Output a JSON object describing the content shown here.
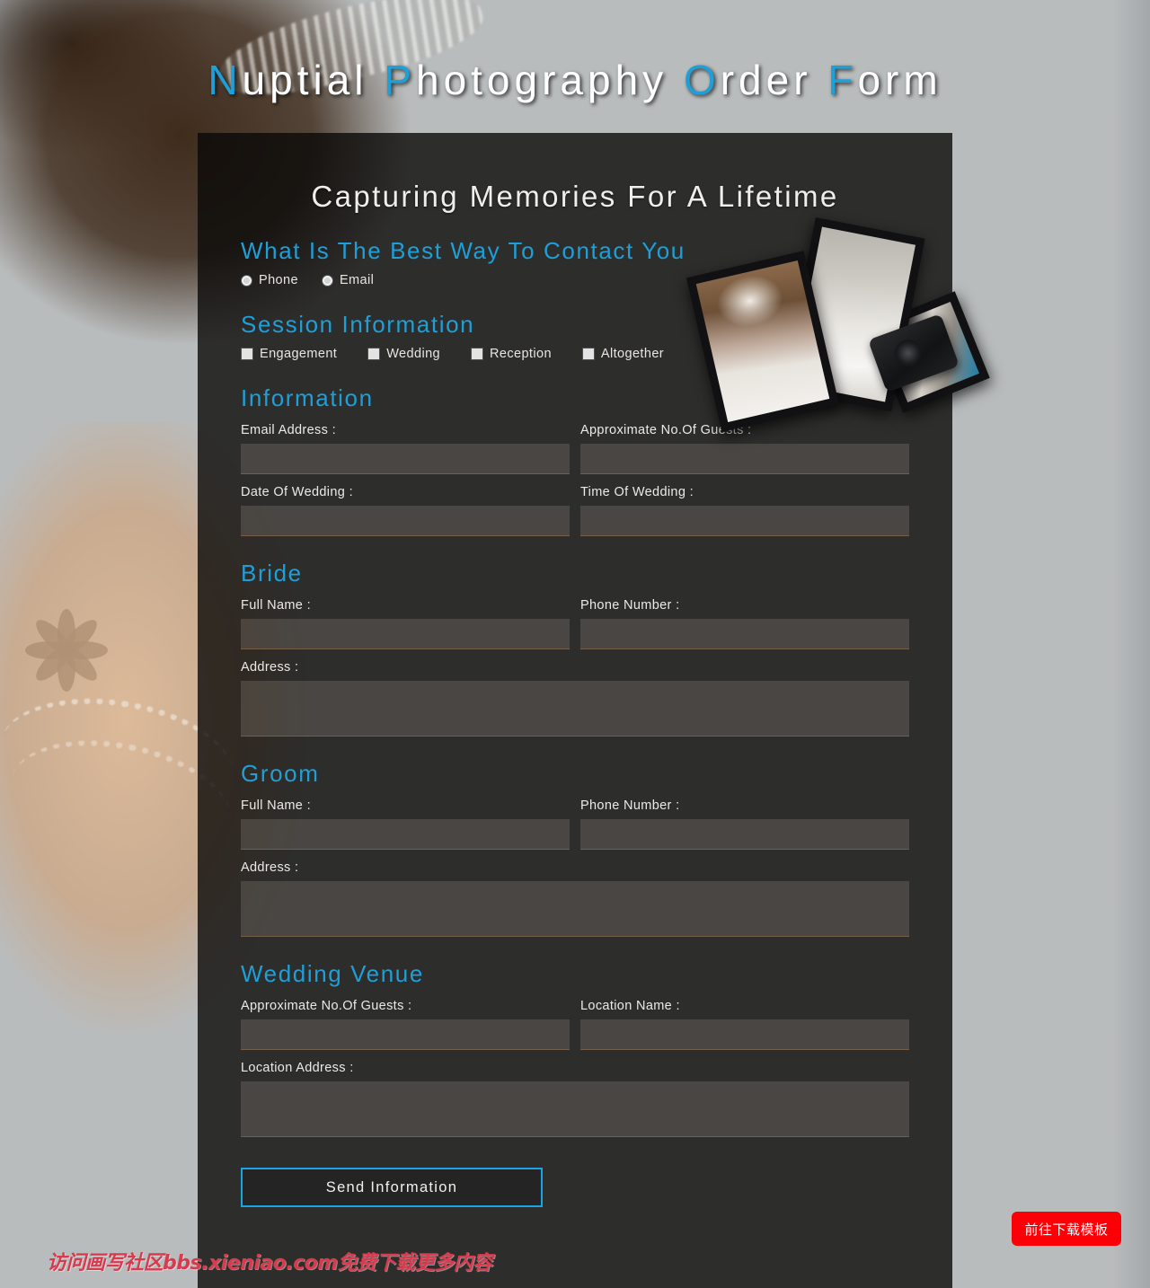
{
  "header": {
    "title_parts": [
      {
        "text": "N",
        "highlight": true
      },
      {
        "text": "uptial ",
        "highlight": false
      },
      {
        "text": "P",
        "highlight": true
      },
      {
        "text": "hotography ",
        "highlight": false
      },
      {
        "text": "O",
        "highlight": true
      },
      {
        "text": "rder ",
        "highlight": false
      },
      {
        "text": "F",
        "highlight": true
      },
      {
        "text": "orm",
        "highlight": false
      }
    ],
    "title_text": "Nuptial Photography Order Form"
  },
  "form": {
    "subtitle": "Capturing Memories For A Lifetime",
    "contact": {
      "heading": "What Is The Best Way To Contact You",
      "options": [
        {
          "label": "Phone",
          "type": "radio",
          "selected": false
        },
        {
          "label": "Email",
          "type": "radio",
          "selected": false
        }
      ]
    },
    "session": {
      "heading": "Session Information",
      "options": [
        {
          "label": "Engagement",
          "type": "checkbox",
          "checked": false
        },
        {
          "label": "Wedding",
          "type": "checkbox",
          "checked": false
        },
        {
          "label": "Reception",
          "type": "checkbox",
          "checked": false
        },
        {
          "label": "Altogether",
          "type": "checkbox",
          "checked": false
        }
      ]
    },
    "information": {
      "heading": "Information",
      "fields": [
        {
          "label": "Email Address :",
          "value": "",
          "placeholder": ""
        },
        {
          "label": "Approximate No.Of Guests :",
          "value": "",
          "placeholder": ""
        },
        {
          "label": "Date Of Wedding :",
          "value": "",
          "placeholder": ""
        },
        {
          "label": "Time Of Wedding :",
          "value": "",
          "placeholder": ""
        }
      ]
    },
    "bride": {
      "heading": "Bride",
      "fields": [
        {
          "label": "Full Name :",
          "value": "",
          "placeholder": ""
        },
        {
          "label": "Phone Number :",
          "value": "",
          "placeholder": ""
        }
      ],
      "address": {
        "label": "Address :",
        "value": "",
        "placeholder": ""
      }
    },
    "groom": {
      "heading": "Groom",
      "fields": [
        {
          "label": "Full Name :",
          "value": "",
          "placeholder": ""
        },
        {
          "label": "Phone Number :",
          "value": "",
          "placeholder": ""
        }
      ],
      "address": {
        "label": "Address :",
        "value": "",
        "placeholder": ""
      }
    },
    "venue": {
      "heading": "Wedding Venue",
      "fields": [
        {
          "label": "Approximate No.Of Guests :",
          "value": "",
          "placeholder": ""
        },
        {
          "label": "Location Name :",
          "value": "",
          "placeholder": ""
        }
      ],
      "address": {
        "label": "Location Address :",
        "value": "",
        "placeholder": ""
      }
    },
    "submit_label": "Send Information"
  },
  "collage": {
    "photos": [
      {
        "name": "bride-seated-portrait"
      },
      {
        "name": "wedding-dress-detail"
      },
      {
        "name": "camera-and-couple"
      }
    ]
  },
  "overlay": {
    "watermark": "访问画写社区bbs.xieniao.com免费下载更多内容",
    "download_button": "前往下载模板"
  },
  "colors": {
    "accent_blue": "#1e9fd8",
    "button_border": "#1ba4e4",
    "panel_bg": "rgba(10,9,8,0.80)",
    "watermark_red": "#d93a4e",
    "download_red": "#fb0007"
  }
}
